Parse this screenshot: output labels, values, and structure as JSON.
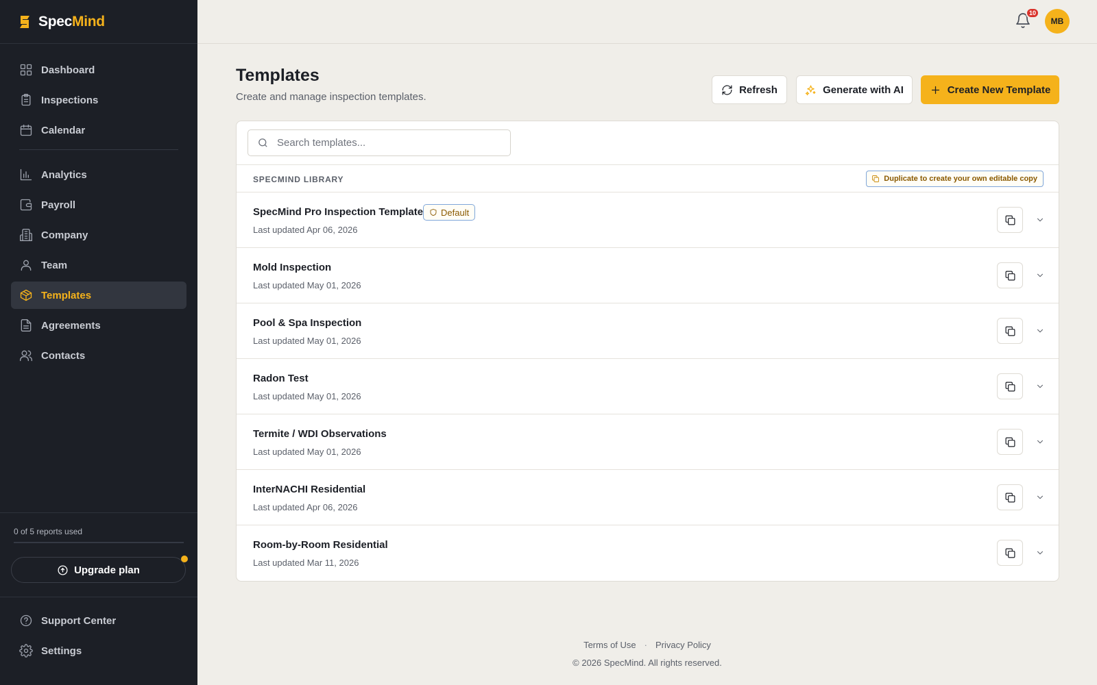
{
  "brand": {
    "name_part1": "Spec",
    "name_part2": "Mind",
    "accent": "#f5b21b"
  },
  "sidebar": {
    "items": [
      {
        "label": "Dashboard",
        "icon": "grid-icon"
      },
      {
        "label": "Inspections",
        "icon": "clipboard-icon"
      },
      {
        "label": "Calendar",
        "icon": "calendar-icon"
      },
      {
        "label": "Analytics",
        "icon": "bar-chart-icon"
      },
      {
        "label": "Payroll",
        "icon": "wallet-icon"
      },
      {
        "label": "Company",
        "icon": "building-icon"
      },
      {
        "label": "Team",
        "icon": "user-icon"
      },
      {
        "label": "Templates",
        "icon": "package-icon",
        "active": true
      },
      {
        "label": "Agreements",
        "icon": "document-icon"
      },
      {
        "label": "Contacts",
        "icon": "users-icon"
      }
    ],
    "usage_text": "0 of 5 reports used",
    "upgrade_label": "Upgrade plan",
    "bottom_items": [
      {
        "label": "Support Center",
        "icon": "help-circle-icon"
      },
      {
        "label": "Settings",
        "icon": "gear-icon"
      }
    ]
  },
  "topbar": {
    "notification_count": "10",
    "avatar_initials": "MB"
  },
  "page": {
    "title": "Templates",
    "subtitle": "Create and manage inspection templates.",
    "refresh_label": "Refresh",
    "ai_label": "Generate with AI",
    "create_label": "Create New Template"
  },
  "search": {
    "placeholder": "Search templates..."
  },
  "library": {
    "title": "SPECMIND LIBRARY",
    "hint": "Duplicate to create your own editable copy",
    "default_badge": "Default",
    "rows": [
      {
        "title": "SpecMind Pro Inspection Template",
        "date": "Last updated Apr 06, 2026",
        "default": true
      },
      {
        "title": "Mold Inspection",
        "date": "Last updated May 01, 2026"
      },
      {
        "title": "Pool & Spa Inspection",
        "date": "Last updated May 01, 2026"
      },
      {
        "title": "Radon Test",
        "date": "Last updated May 01, 2026"
      },
      {
        "title": "Termite / WDI Observations",
        "date": "Last updated May 01, 2026"
      },
      {
        "title": "InterNACHI Residential",
        "date": "Last updated Apr 06, 2026"
      },
      {
        "title": "Room-by-Room Residential",
        "date": "Last updated Mar 11, 2026"
      }
    ]
  },
  "footer": {
    "terms": "Terms of Use",
    "separator": "·",
    "privacy": "Privacy Policy",
    "copyright": "© 2026 SpecMind. All rights reserved."
  }
}
